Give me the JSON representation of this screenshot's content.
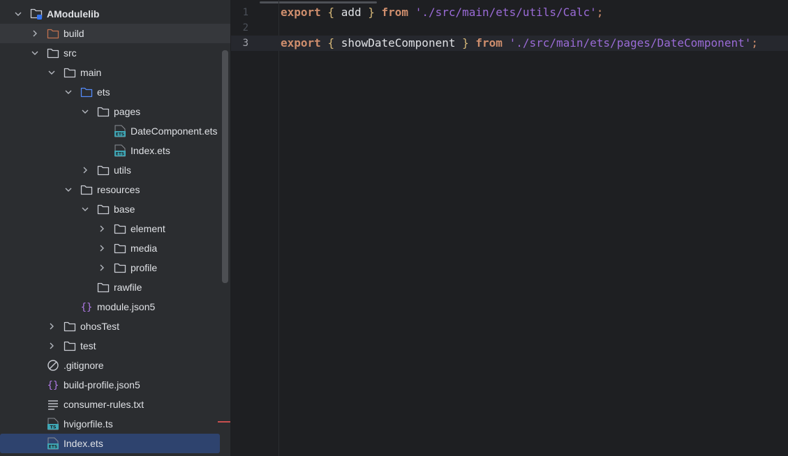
{
  "project_tree": {
    "items": [
      {
        "label": "AModulelib",
        "depth": 0,
        "expanded": true,
        "icon": "module-folder-icon",
        "bold": true
      },
      {
        "label": "build",
        "depth": 1,
        "expanded": false,
        "icon": "build-folder-icon"
      },
      {
        "label": "src",
        "depth": 1,
        "expanded": true,
        "icon": "folder-icon"
      },
      {
        "label": "main",
        "depth": 2,
        "expanded": true,
        "icon": "folder-icon"
      },
      {
        "label": "ets",
        "depth": 3,
        "expanded": true,
        "icon": "source-folder-icon"
      },
      {
        "label": "pages",
        "depth": 4,
        "expanded": true,
        "icon": "folder-icon"
      },
      {
        "label": "DateComponent.ets",
        "depth": 5,
        "icon": "ets-file-icon"
      },
      {
        "label": "Index.ets",
        "depth": 5,
        "icon": "ets-file-icon"
      },
      {
        "label": "utils",
        "depth": 4,
        "expanded": false,
        "icon": "folder-icon"
      },
      {
        "label": "resources",
        "depth": 3,
        "expanded": true,
        "icon": "folder-icon"
      },
      {
        "label": "base",
        "depth": 4,
        "expanded": true,
        "icon": "folder-icon"
      },
      {
        "label": "element",
        "depth": 5,
        "expanded": false,
        "icon": "folder-icon"
      },
      {
        "label": "media",
        "depth": 5,
        "expanded": false,
        "icon": "folder-icon"
      },
      {
        "label": "profile",
        "depth": 5,
        "expanded": false,
        "icon": "folder-icon"
      },
      {
        "label": "rawfile",
        "depth": 4,
        "icon": "folder-icon"
      },
      {
        "label": "module.json5",
        "depth": 3,
        "icon": "json-file-icon"
      },
      {
        "label": "ohosTest",
        "depth": 2,
        "expanded": false,
        "icon": "folder-icon"
      },
      {
        "label": "test",
        "depth": 2,
        "expanded": false,
        "icon": "folder-icon"
      },
      {
        "label": ".gitignore",
        "depth": 1,
        "icon": "ignore-file-icon"
      },
      {
        "label": "build-profile.json5",
        "depth": 1,
        "icon": "json-file-icon"
      },
      {
        "label": "consumer-rules.txt",
        "depth": 1,
        "icon": "text-file-icon"
      },
      {
        "label": "hvigorfile.ts",
        "depth": 1,
        "icon": "ts-file-icon"
      },
      {
        "label": "Index.ets",
        "depth": 1,
        "icon": "ets-file-icon",
        "selected": true
      }
    ]
  },
  "editor": {
    "line_numbers": [
      "1",
      "2",
      "3"
    ],
    "current_line": "3",
    "lines": [
      [
        {
          "t": "export",
          "c": "kw"
        },
        {
          "t": " ",
          "c": "id"
        },
        {
          "t": "{",
          "c": "br"
        },
        {
          "t": " add ",
          "c": "id"
        },
        {
          "t": "}",
          "c": "br"
        },
        {
          "t": " ",
          "c": "id"
        },
        {
          "t": "from",
          "c": "kw"
        },
        {
          "t": " ",
          "c": "id"
        },
        {
          "t": "'./src/main/ets/utils/Calc'",
          "c": "str"
        },
        {
          "t": ";",
          "c": "pn"
        }
      ],
      [],
      [
        {
          "t": "export",
          "c": "kw"
        },
        {
          "t": " ",
          "c": "id"
        },
        {
          "t": "{",
          "c": "br"
        },
        {
          "t": " showDateComponent ",
          "c": "id"
        },
        {
          "t": "}",
          "c": "br"
        },
        {
          "t": " ",
          "c": "id"
        },
        {
          "t": "from",
          "c": "kw"
        },
        {
          "t": " ",
          "c": "id"
        },
        {
          "t": "'./src/main/ets/pages/DateComponent'",
          "c": "str"
        },
        {
          "t": ";",
          "c": "pn"
        }
      ]
    ]
  },
  "colors": {
    "panel_bg": "#2b2d30",
    "editor_bg": "#1e1f22",
    "selection": "#2e436e",
    "keyword": "#cf8e6d",
    "string": "#9a6bd6",
    "brace": "#d5b778",
    "folder": "#c9ccd3",
    "build_folder": "#c0714f",
    "source_folder": "#548af7",
    "json_icon": "#b07ae6",
    "ets_icon": "#3fa7b6"
  }
}
